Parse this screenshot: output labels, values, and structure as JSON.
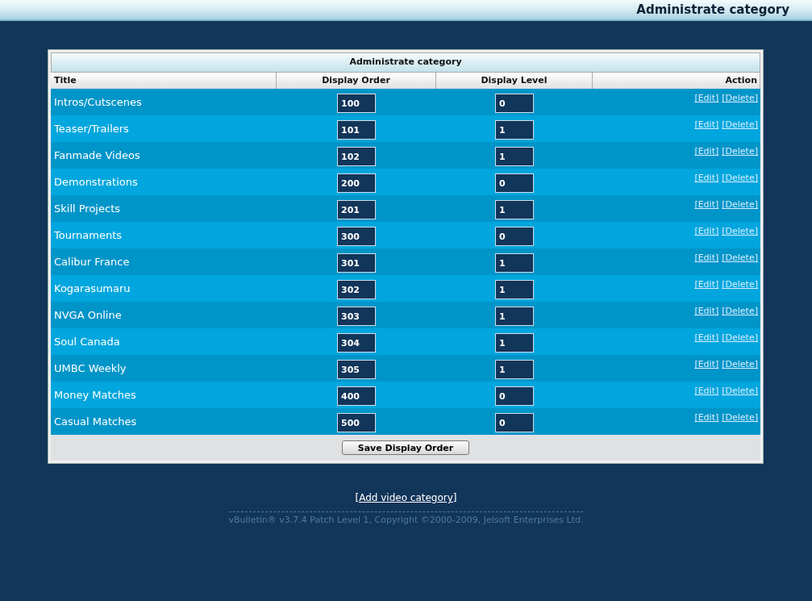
{
  "header": {
    "title": "Administrate category"
  },
  "table": {
    "title": "Administrate category",
    "columns": [
      "Title",
      "Display Order",
      "Display Level",
      "Action"
    ],
    "rows": [
      {
        "title": "Intros/Cutscenes",
        "display_order": "100",
        "display_level": "0",
        "edit": "[Edit]",
        "delete": "[Delete]"
      },
      {
        "title": "Teaser/Trailers",
        "display_order": "101",
        "display_level": "1",
        "edit": "[Edit]",
        "delete": "[Delete]"
      },
      {
        "title": "Fanmade Videos",
        "display_order": "102",
        "display_level": "1",
        "edit": "[Edit]",
        "delete": "[Delete]"
      },
      {
        "title": "Demonstrations",
        "display_order": "200",
        "display_level": "0",
        "edit": "[Edit]",
        "delete": "[Delete]"
      },
      {
        "title": "Skill Projects",
        "display_order": "201",
        "display_level": "1",
        "edit": "[Edit]",
        "delete": "[Delete]"
      },
      {
        "title": "Tournaments",
        "display_order": "300",
        "display_level": "0",
        "edit": "[Edit]",
        "delete": "[Delete]"
      },
      {
        "title": "Calibur France",
        "display_order": "301",
        "display_level": "1",
        "edit": "[Edit]",
        "delete": "[Delete]"
      },
      {
        "title": "Kogarasumaru",
        "display_order": "302",
        "display_level": "1",
        "edit": "[Edit]",
        "delete": "[Delete]"
      },
      {
        "title": "NVGA Online",
        "display_order": "303",
        "display_level": "1",
        "edit": "[Edit]",
        "delete": "[Delete]"
      },
      {
        "title": "Soul Canada",
        "display_order": "304",
        "display_level": "1",
        "edit": "[Edit]",
        "delete": "[Delete]"
      },
      {
        "title": "UMBC Weekly",
        "display_order": "305",
        "display_level": "1",
        "edit": "[Edit]",
        "delete": "[Delete]"
      },
      {
        "title": "Money Matches",
        "display_order": "400",
        "display_level": "0",
        "edit": "[Edit]",
        "delete": "[Delete]"
      },
      {
        "title": "Casual Matches",
        "display_order": "500",
        "display_level": "0",
        "edit": "[Edit]",
        "delete": "[Delete]"
      }
    ],
    "save_button": "Save Display Order"
  },
  "add_link": "[Add video category]",
  "footer": "vBulletin® v3.7.4 Patch Level 1, Copyright ©2000-2009, Jelsoft Enterprises Ltd."
}
